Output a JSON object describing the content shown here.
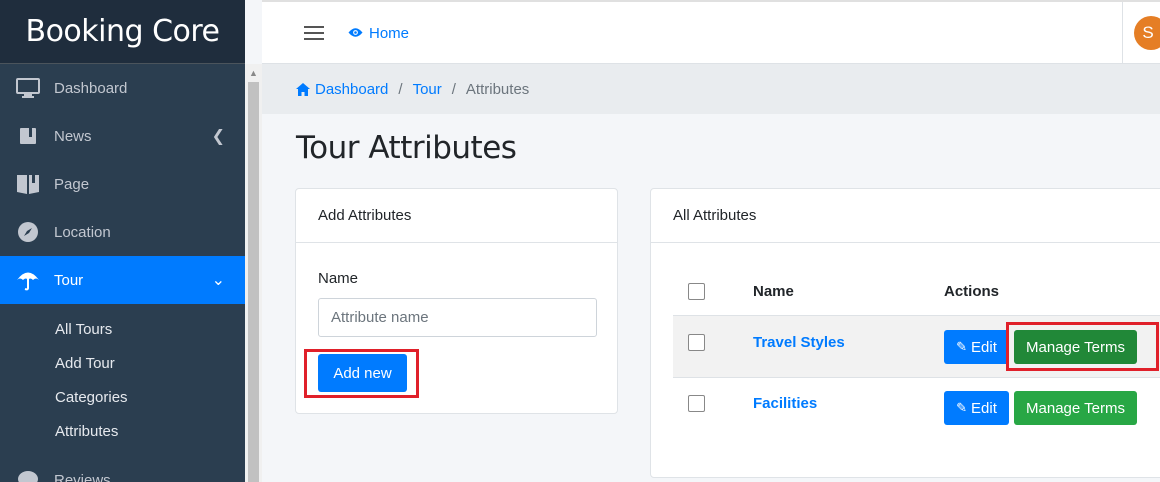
{
  "brand": {
    "title": "Booking Core"
  },
  "sidebar": {
    "items": [
      {
        "label": "Dashboard",
        "icon": "monitor-icon"
      },
      {
        "label": "News",
        "icon": "book-icon"
      },
      {
        "label": "Page",
        "icon": "page-icon"
      },
      {
        "label": "Location",
        "icon": "compass-icon"
      },
      {
        "label": "Tour",
        "icon": "umbrella-icon"
      },
      {
        "label": "Reviews",
        "icon": "comment-icon"
      }
    ],
    "tour_subitems": [
      "All Tours",
      "Add Tour",
      "Categories",
      "Attributes"
    ]
  },
  "topbar": {
    "home_label": "Home",
    "avatar_initial": "S"
  },
  "breadcrumb": {
    "dashboard": "Dashboard",
    "tour": "Tour",
    "current": "Attributes",
    "sep": "/"
  },
  "page": {
    "title": "Tour Attributes"
  },
  "add_card": {
    "header": "Add Attributes",
    "name_label": "Name",
    "name_placeholder": "Attribute name",
    "button": "Add new"
  },
  "all_card": {
    "header": "All Attributes",
    "columns": [
      "Name",
      "Actions"
    ],
    "rows": [
      {
        "name": "Travel Styles",
        "edit": "Edit",
        "manage": "Manage Terms"
      },
      {
        "name": "Facilities",
        "edit": "Edit",
        "manage": "Manage Terms"
      }
    ]
  },
  "colors": {
    "primary": "#007bff",
    "success": "#28a745",
    "sidebar": "#2b3e50",
    "highlight": "#e0202a"
  }
}
